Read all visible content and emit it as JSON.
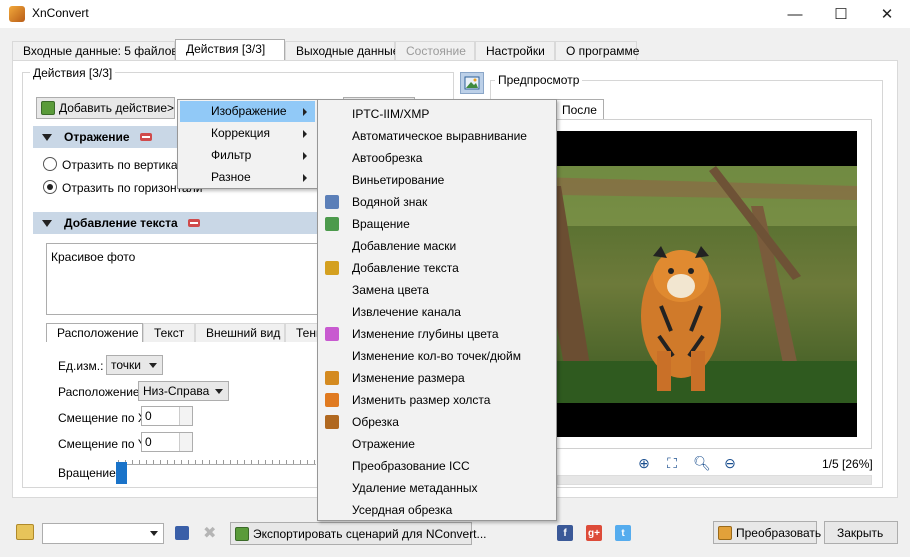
{
  "window": {
    "title": "XnConvert",
    "minimize": "—",
    "maximize": "☐",
    "close": "✕"
  },
  "tabs": [
    {
      "label": "Входные данные: 5 файлов",
      "state": "normal"
    },
    {
      "label": "Действия [3/3]",
      "state": "active"
    },
    {
      "label": "Выходные данные",
      "state": "normal"
    },
    {
      "label": "Состояние",
      "state": "disabled"
    },
    {
      "label": "Настройки",
      "state": "normal"
    },
    {
      "label": "О программе",
      "state": "normal"
    }
  ],
  "actions": {
    "group_title": "Действия [3/3]",
    "add_button": "Добавить действие>",
    "reflection": {
      "title": "Отражение",
      "options": [
        "Отразить по вертикали",
        "Отразить по горизонтали"
      ],
      "selected_index": 1
    },
    "add_text": {
      "title": "Добавление текста",
      "text_value": "Красивое фото",
      "tabs": [
        "Расположение",
        "Текст",
        "Внешний вид",
        "Тень"
      ],
      "units_label": "Ед.изм.:",
      "units_value": "точки",
      "position_label": "Расположение",
      "position_value": "Низ-Справа",
      "offset_x_label": "Смещение по X",
      "offset_x_value": "0",
      "offset_y_label": "Смещение по Y",
      "offset_y_value": "0",
      "rotation_label": "Вращение",
      "rotation_value": 0
    }
  },
  "preview": {
    "group_title": "Предпросмотр",
    "tab": "После",
    "page_info": "1/5 [26%]",
    "tools": [
      "zoom-in-icon",
      "fit-icon",
      "zoom-icon",
      "zoom-out-icon"
    ]
  },
  "menu": {
    "categories": [
      "Изображение",
      "Коррекция",
      "Фильтр",
      "Разное"
    ],
    "highlighted": "Изображение",
    "items": [
      {
        "label": "IPTC-IIM/XMP",
        "icon": ""
      },
      {
        "label": "Автоматическое выравнивание",
        "icon": ""
      },
      {
        "label": "Автообрезка",
        "icon": ""
      },
      {
        "label": "Виньетирование",
        "icon": ""
      },
      {
        "label": "Водяной знак",
        "icon": "watermark-icon"
      },
      {
        "label": "Вращение",
        "icon": "rotate-icon"
      },
      {
        "label": "Добавление маски",
        "icon": ""
      },
      {
        "label": "Добавление текста",
        "icon": "text-icon"
      },
      {
        "label": "Замена цвета",
        "icon": ""
      },
      {
        "label": "Извлечение канала",
        "icon": ""
      },
      {
        "label": "Изменение глубины цвета",
        "icon": "color-depth-icon"
      },
      {
        "label": "Изменение кол-во точек/дюйм",
        "icon": ""
      },
      {
        "label": "Изменение размера",
        "icon": "resize-icon"
      },
      {
        "label": "Изменить размер холста",
        "icon": "canvas-icon"
      },
      {
        "label": "Обрезка",
        "icon": "crop-icon"
      },
      {
        "label": "Отражение",
        "icon": ""
      },
      {
        "label": "Преобразование ICC",
        "icon": ""
      },
      {
        "label": "Удаление метаданных",
        "icon": ""
      },
      {
        "label": "Усердная обрезка",
        "icon": ""
      }
    ]
  },
  "bottom": {
    "export_button": "Экспортировать сценарий для NConvert...",
    "convert_button": "Преобразовать",
    "close_button": "Закрыть",
    "social": [
      "f",
      "g+",
      "t"
    ]
  },
  "colors": {
    "menu_highlight": "#91c9f7",
    "section_header": "#c9d7e6",
    "slider": "#1a73c9"
  }
}
